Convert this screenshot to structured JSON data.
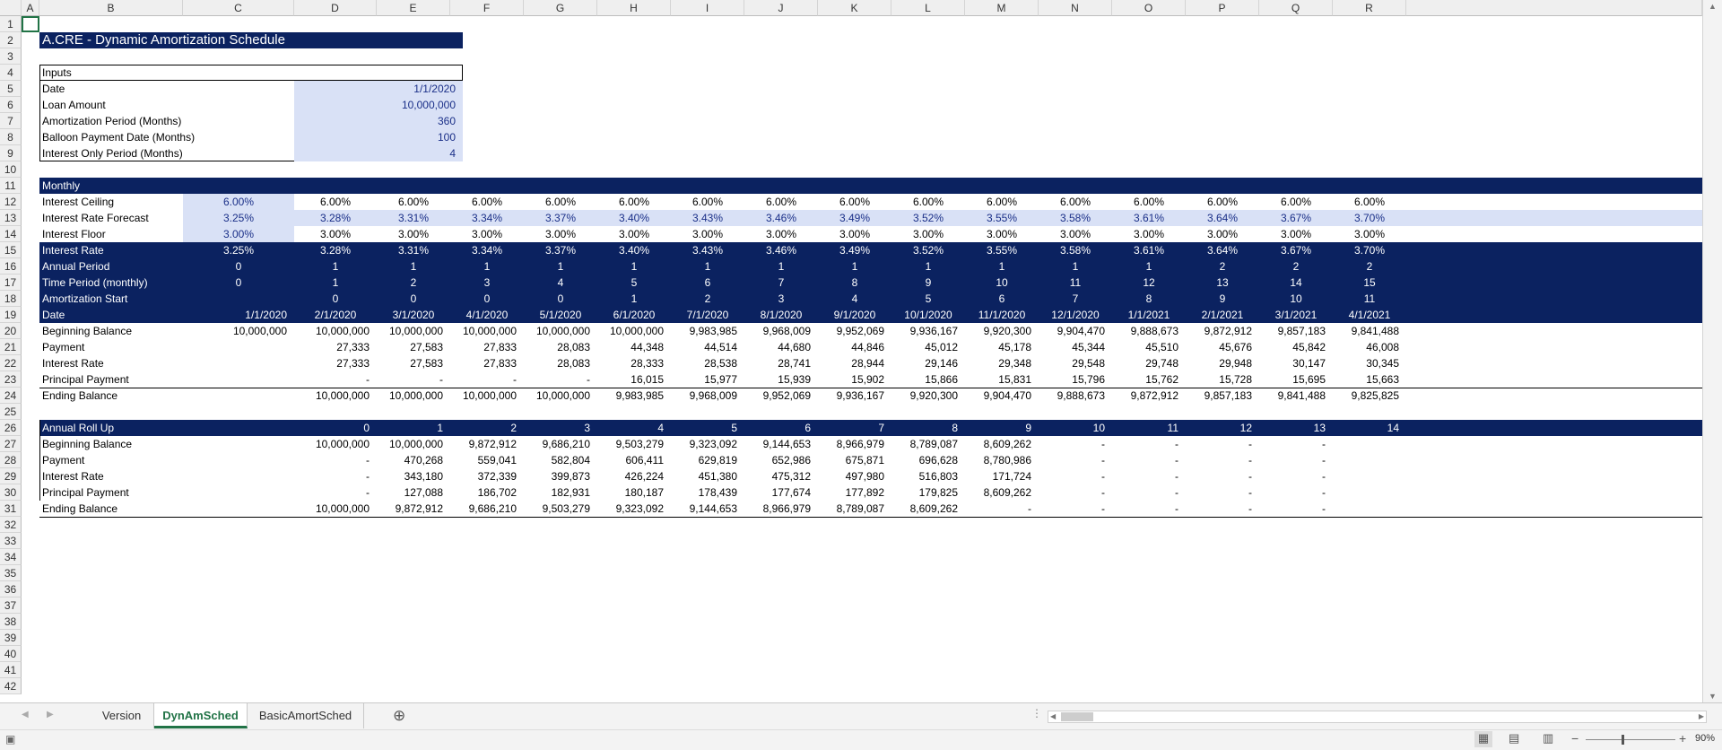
{
  "sheet": {
    "columns": [
      "A",
      "B",
      "C",
      "D",
      "E",
      "F",
      "G",
      "H",
      "I",
      "J",
      "K",
      "L",
      "M",
      "N",
      "O",
      "P",
      "Q",
      "R"
    ],
    "rows": [
      "1",
      "2",
      "3",
      "4",
      "5",
      "6",
      "7",
      "8",
      "9",
      "10",
      "11",
      "12",
      "13",
      "14",
      "15",
      "16",
      "17",
      "18",
      "19",
      "20",
      "21",
      "22",
      "23",
      "24",
      "25",
      "26",
      "27",
      "28",
      "29",
      "30",
      "31",
      "32",
      "33",
      "34",
      "35",
      "36",
      "37",
      "38",
      "39",
      "40",
      "41",
      "42"
    ]
  },
  "title": "A.CRE - Dynamic Amortization Schedule",
  "inputs": {
    "header": "Inputs",
    "rows": [
      {
        "label": "Date",
        "value": "1/1/2020"
      },
      {
        "label": "Loan Amount",
        "value": "10,000,000"
      },
      {
        "label": "Amortization Period (Months)",
        "value": "360"
      },
      {
        "label": "Balloon Payment Date (Months)",
        "value": "100"
      },
      {
        "label": "Interest Only Period (Months)",
        "value": "4"
      }
    ]
  },
  "monthly": {
    "header": "Monthly",
    "rows": [
      {
        "label": "Interest Ceiling",
        "style": "plain",
        "values": [
          "6.00%",
          "6.00%",
          "6.00%",
          "6.00%",
          "6.00%",
          "6.00%",
          "6.00%",
          "6.00%",
          "6.00%",
          "6.00%",
          "6.00%",
          "6.00%",
          "6.00%",
          "6.00%",
          "6.00%",
          "6.00%"
        ]
      },
      {
        "label": "Interest Rate Forecast",
        "style": "input",
        "values": [
          "3.25%",
          "3.28%",
          "3.31%",
          "3.34%",
          "3.37%",
          "3.40%",
          "3.43%",
          "3.46%",
          "3.49%",
          "3.52%",
          "3.55%",
          "3.58%",
          "3.61%",
          "3.64%",
          "3.67%",
          "3.70%"
        ]
      },
      {
        "label": "Interest Floor",
        "style": "plain",
        "values": [
          "3.00%",
          "3.00%",
          "3.00%",
          "3.00%",
          "3.00%",
          "3.00%",
          "3.00%",
          "3.00%",
          "3.00%",
          "3.00%",
          "3.00%",
          "3.00%",
          "3.00%",
          "3.00%",
          "3.00%",
          "3.00%"
        ]
      },
      {
        "label": "Interest Rate",
        "style": "band",
        "values": [
          "3.25%",
          "3.28%",
          "3.31%",
          "3.34%",
          "3.37%",
          "3.40%",
          "3.43%",
          "3.46%",
          "3.49%",
          "3.52%",
          "3.55%",
          "3.58%",
          "3.61%",
          "3.64%",
          "3.67%",
          "3.70%"
        ]
      },
      {
        "label": "Annual Period",
        "style": "band",
        "values": [
          "0",
          "1",
          "1",
          "1",
          "1",
          "1",
          "1",
          "1",
          "1",
          "1",
          "1",
          "1",
          "1",
          "2",
          "2",
          "2"
        ]
      },
      {
        "label": "Time Period (monthly)",
        "style": "band",
        "values": [
          "0",
          "1",
          "2",
          "3",
          "4",
          "5",
          "6",
          "7",
          "8",
          "9",
          "10",
          "11",
          "12",
          "13",
          "14",
          "15"
        ]
      },
      {
        "label": "Amortization Start",
        "style": "band",
        "values": [
          "",
          "0",
          "0",
          "0",
          "0",
          "1",
          "2",
          "3",
          "4",
          "5",
          "6",
          "7",
          "8",
          "9",
          "10",
          "11"
        ]
      },
      {
        "label": "Date",
        "style": "band",
        "values": [
          "1/1/2020",
          "2/1/2020",
          "3/1/2020",
          "4/1/2020",
          "5/1/2020",
          "6/1/2020",
          "7/1/2020",
          "8/1/2020",
          "9/1/2020",
          "10/1/2020",
          "11/1/2020",
          "12/1/2020",
          "1/1/2021",
          "2/1/2021",
          "3/1/2021",
          "4/1/2021"
        ]
      },
      {
        "label": "Beginning Balance",
        "style": "num",
        "values": [
          "10,000,000",
          "10,000,000",
          "10,000,000",
          "10,000,000",
          "10,000,000",
          "10,000,000",
          "9,983,985",
          "9,968,009",
          "9,952,069",
          "9,936,167",
          "9,920,300",
          "9,904,470",
          "9,888,673",
          "9,872,912",
          "9,857,183",
          "9,841,488"
        ]
      },
      {
        "label": "Payment",
        "style": "num",
        "values": [
          "",
          "27,333",
          "27,583",
          "27,833",
          "28,083",
          "44,348",
          "44,514",
          "44,680",
          "44,846",
          "45,012",
          "45,178",
          "45,344",
          "45,510",
          "45,676",
          "45,842",
          "46,008"
        ]
      },
      {
        "label": "Interest Rate",
        "style": "num",
        "values": [
          "",
          "27,333",
          "27,583",
          "27,833",
          "28,083",
          "28,333",
          "28,538",
          "28,741",
          "28,944",
          "29,146",
          "29,348",
          "29,548",
          "29,748",
          "29,948",
          "30,147",
          "30,345"
        ]
      },
      {
        "label": "Principal Payment",
        "style": "num",
        "values": [
          "",
          "-",
          "-",
          "-",
          "-",
          "16,015",
          "15,977",
          "15,939",
          "15,902",
          "15,866",
          "15,831",
          "15,796",
          "15,762",
          "15,728",
          "15,695",
          "15,663"
        ]
      },
      {
        "label": "Ending Balance",
        "style": "num",
        "values": [
          "",
          "10,000,000",
          "10,000,000",
          "10,000,000",
          "10,000,000",
          "9,983,985",
          "9,968,009",
          "9,952,069",
          "9,936,167",
          "9,920,300",
          "9,904,470",
          "9,888,673",
          "9,872,912",
          "9,857,183",
          "9,841,488",
          "9,825,825"
        ]
      }
    ]
  },
  "annual": {
    "header": "Annual Roll Up",
    "years": [
      "0",
      "1",
      "2",
      "3",
      "4",
      "5",
      "6",
      "7",
      "8",
      "9",
      "10",
      "11",
      "12",
      "13",
      "14"
    ],
    "rows": [
      {
        "label": "Beginning Balance",
        "values": [
          "10,000,000",
          "10,000,000",
          "9,872,912",
          "9,686,210",
          "9,503,279",
          "9,323,092",
          "9,144,653",
          "8,966,979",
          "8,789,087",
          "8,609,262",
          "-",
          "-",
          "-",
          "-",
          ""
        ]
      },
      {
        "label": "Payment",
        "values": [
          "-",
          "470,268",
          "559,041",
          "582,804",
          "606,411",
          "629,819",
          "652,986",
          "675,871",
          "696,628",
          "8,780,986",
          "-",
          "-",
          "-",
          "-",
          ""
        ]
      },
      {
        "label": "Interest Rate",
        "values": [
          "-",
          "343,180",
          "372,339",
          "399,873",
          "426,224",
          "451,380",
          "475,312",
          "497,980",
          "516,803",
          "171,724",
          "-",
          "-",
          "-",
          "-",
          ""
        ]
      },
      {
        "label": "Principal Payment",
        "values": [
          "-",
          "127,088",
          "186,702",
          "182,931",
          "180,187",
          "178,439",
          "177,674",
          "177,892",
          "179,825",
          "8,609,262",
          "-",
          "-",
          "-",
          "-",
          ""
        ]
      },
      {
        "label": "Ending Balance",
        "values": [
          "10,000,000",
          "9,872,912",
          "9,686,210",
          "9,503,279",
          "9,323,092",
          "9,144,653",
          "8,966,979",
          "8,789,087",
          "8,609,262",
          "-",
          "-",
          "-",
          "-",
          "-",
          ""
        ]
      }
    ]
  },
  "tabs": {
    "items": [
      {
        "label": "Version",
        "active": false
      },
      {
        "label": "DynAmSched",
        "active": true
      },
      {
        "label": "BasicAmortSched",
        "active": false
      }
    ],
    "add_symbol": "⊕"
  },
  "status": {
    "zoom": "90%"
  }
}
